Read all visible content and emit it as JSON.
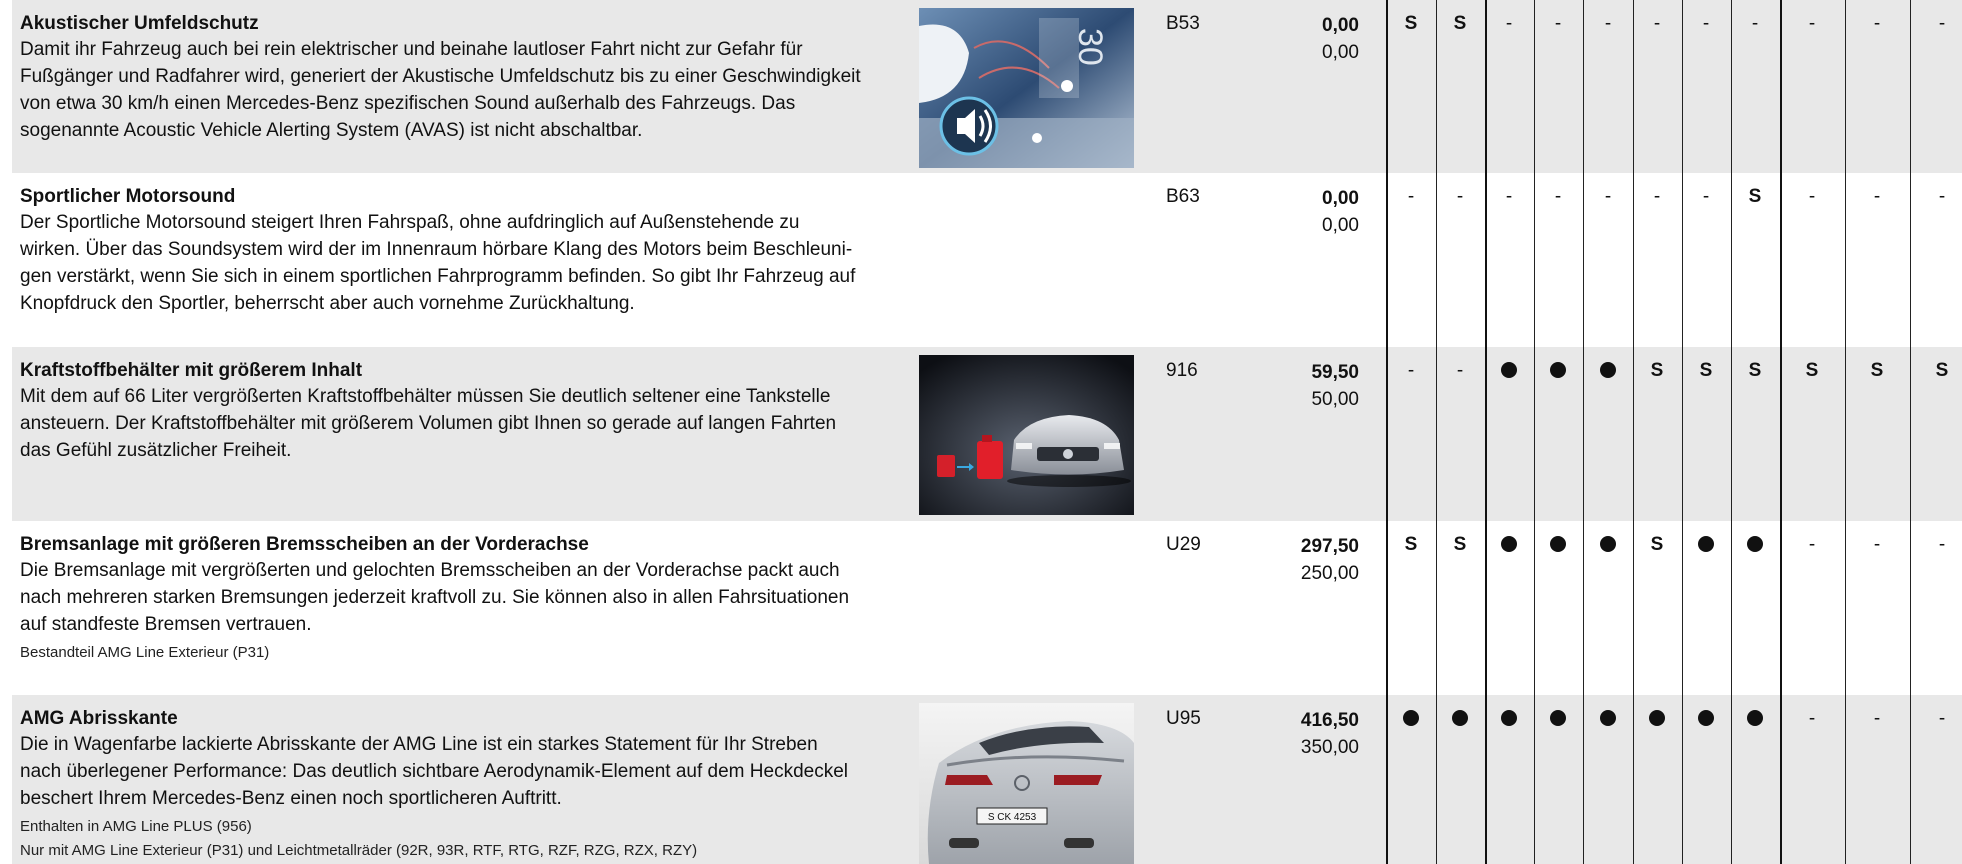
{
  "rows": [
    {
      "title": "Akustischer Umfeldschutz",
      "lines": [
        "Damit ihr Fahrzeug auch bei rein elektrischer und beinahe lautloser Fahrt nicht zur Gefahr für",
        "Fußgänger und Radfahrer wird, generiert der Akustische Umfeldschutz bis zu einer Geschwindigkeit",
        "von etwa 30 km/h einen Mercedes-Benz spezifischen Sound außerhalb des Fahrzeugs. Das",
        "sogenannte Acoustic Vehicle Alerting System (AVAS) ist nicht abschaltbar."
      ],
      "notes": [],
      "image": "avas-illustration",
      "code": "B53",
      "price_gross": "0,00",
      "price_net": "0,00",
      "availability": [
        "S",
        "S",
        "-",
        "-",
        "-",
        "-",
        "-",
        "-",
        "-",
        "-",
        "-"
      ]
    },
    {
      "title": "Sportlicher Motorsound",
      "lines": [
        "Der Sportliche Motorsound steigert Ihren Fahrspaß, ohne aufdringlich auf Außenstehende zu",
        "wirken. Über das Soundsystem wird der im Innenraum hörbare Klang des Motors beim Beschleuni-",
        "gen verstärkt, wenn Sie sich in einem sportlichen Fahrprogramm befinden. So gibt Ihr Fahrzeug auf",
        "Knopfdruck den Sportler, beherrscht aber auch vornehme Zurückhaltung."
      ],
      "notes": [],
      "image": null,
      "code": "B63",
      "price_gross": "0,00",
      "price_net": "0,00",
      "availability": [
        "-",
        "-",
        "-",
        "-",
        "-",
        "-",
        "-",
        "S",
        "-",
        "-",
        "-"
      ]
    },
    {
      "title": "Kraftstoffbehälter mit größerem Inhalt",
      "lines": [
        "Mit dem auf 66 Liter vergrößerten Kraftstoffbehälter müssen Sie deutlich seltener eine Tankstelle",
        "ansteuern. Der Kraftstoffbehälter mit größerem Volumen gibt Ihnen so gerade auf langen Fahrten",
        "das Gefühl zusätzlicher Freiheit."
      ],
      "notes": [],
      "image": "fuel-tank-illustration",
      "code": "916",
      "price_gross": "59,50",
      "price_net": "50,00",
      "availability": [
        "-",
        "-",
        "●",
        "●",
        "●",
        "S",
        "S",
        "S",
        "S",
        "S",
        "S"
      ]
    },
    {
      "title": "Bremsanlage mit größeren Bremsscheiben an der Vorderachse",
      "lines": [
        "Die Bremsanlage mit vergrößerten und gelochten Bremsscheiben an der Vorderachse packt auch",
        "nach mehreren starken Bremsungen jederzeit kraftvoll zu. Sie können also in allen Fahrsituationen",
        "auf standfeste Bremsen vertrauen."
      ],
      "notes": [
        "Bestandteil AMG Line Exterieur (P31)"
      ],
      "image": null,
      "code": "U29",
      "price_gross": "297,50",
      "price_net": "250,00",
      "availability": [
        "S",
        "S",
        "●",
        "●",
        "●",
        "S",
        "●",
        "●",
        "-",
        "-",
        "-"
      ]
    },
    {
      "title": "AMG Abrisskante",
      "lines": [
        "Die in Wagenfarbe lackierte Abrisskante der AMG Line ist ein starkes Statement für Ihr Streben",
        "nach überlegener Performance: Das deutlich sichtbare Aerodynamik-Element auf dem Heckdeckel",
        "beschert Ihrem Mercedes-Benz einen noch sportlicheren Auftritt."
      ],
      "notes": [
        "Enthalten in AMG Line PLUS (956)",
        "Nur mit AMG Line Exterieur (P31) und Leichtmetallräder (92R, 93R, RTF, RTG, RZF, RZG, RZX, RZY)"
      ],
      "image": "rear-spoiler-photo",
      "plate": "S CK 4253",
      "code": "U95",
      "price_gross": "416,50",
      "price_net": "350,00",
      "availability": [
        "●",
        "●",
        "●",
        "●",
        "●",
        "●",
        "●",
        "●",
        "-",
        "-",
        "-"
      ]
    }
  ]
}
